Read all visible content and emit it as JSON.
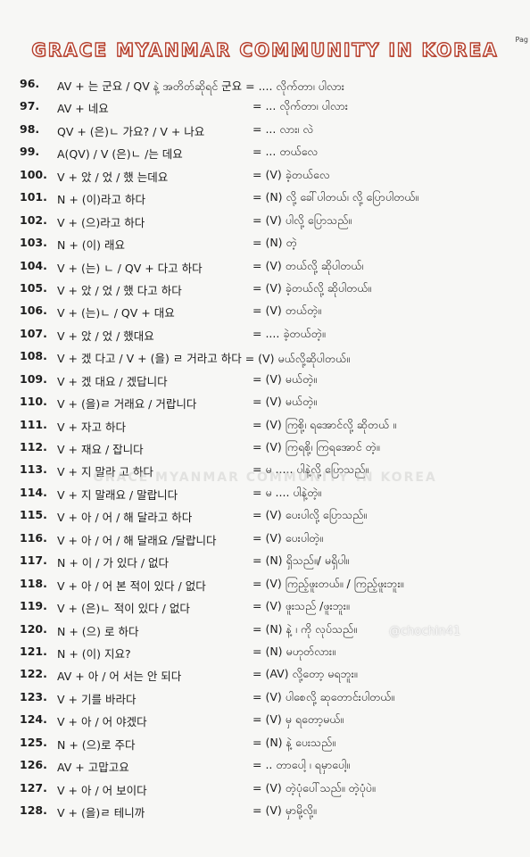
{
  "header": {
    "title": "GRACE MYANMAR COMMUNITY IN KOREA",
    "page_label": "Pag"
  },
  "watermark": "GRACE MYANMAR COMMUNITY IN KOREA",
  "credit": "@chochin41",
  "rows": [
    {
      "num": "96.",
      "form": "AV + 는 군요 / QV နဲ့ အတိတ်ဆိုရင် 군요 = .... လိုက်တာ၊ ပါလား",
      "meaning": ""
    },
    {
      "num": "97.",
      "form": "AV + 네요",
      "meaning": "= ... လိုက်တာ၊ ပါလား"
    },
    {
      "num": "98.",
      "form": "QV + (은)ㄴ 가요? / V + 나요",
      "meaning": "= ... လား၊ လဲ"
    },
    {
      "num": "99.",
      "form": "A(QV) / V (은)ㄴ /는 데요",
      "meaning": "= ... တယ်လေ"
    },
    {
      "num": "100.",
      "form": "V + 았 / 었 / 했 는데요",
      "meaning": "= (V) ခဲ့တယ်လေ"
    },
    {
      "num": "101.",
      "form": "N + (이)라고 하다",
      "meaning": "= (N) လို့ ခေါ်ပါတယ်၊ လို့ ပြောပါတယ်။"
    },
    {
      "num": "102.",
      "form": "V + (으)라고 하다",
      "meaning": "= (V) ပါလို့ ပြောသည်။"
    },
    {
      "num": "103.",
      "form": "N + (이) 래요",
      "meaning": "= (N) တဲ့"
    },
    {
      "num": "104.",
      "form": "V + (는) ㄴ / QV + 다고 하다",
      "meaning": "= (V) တယ်လို့ ဆိုပါတယ်၊"
    },
    {
      "num": "105.",
      "form": "V + 았 / 었 / 했 다고 하다",
      "meaning": "= (V) ခဲ့တယ်လို့ ဆိုပါတယ်။"
    },
    {
      "num": "106.",
      "form": "V + (는)ㄴ / QV + 대요",
      "meaning": "= (V) တယ်တဲ့။"
    },
    {
      "num": "107.",
      "form": "V + 았 / 었 / 했대요",
      "meaning": "= .... ခဲ့တယ်တဲ့။"
    },
    {
      "num": "108.",
      "form": "V + 겠 다고 / V + (을) ㄹ 거라고 하다 = (V) မယ်လို့ဆိုပါတယ်။",
      "meaning": ""
    },
    {
      "num": "109.",
      "form": "V + 겠 대요 / 겠답니다",
      "meaning": "= (V) မယ်တဲ့။"
    },
    {
      "num": "110.",
      "form": "V + (을)ㄹ 거래요 / 거랍니다",
      "meaning": "= (V) မယ်တဲ့။"
    },
    {
      "num": "111.",
      "form": "V + 자고 하다",
      "meaning": "= (V) ကြစို့၊ ရအောင်လို့ ဆိုတယ် ။"
    },
    {
      "num": "112.",
      "form": "V + 재요 / 잡니다",
      "meaning": "= (V) ကြရစို့၊ ကြရအောင် တဲ့။"
    },
    {
      "num": "113.",
      "form": "V + 지 말라 고 하다",
      "meaning": "= မ ..... ပါနဲ့လို့ ပြောသည်။"
    },
    {
      "num": "114.",
      "form": "V + 지 말래요 / 말랍니다",
      "meaning": "= မ .... ပါနဲ့တဲ့။"
    },
    {
      "num": "115.",
      "form": "V + 아 / 어 / 해 달라고 하다",
      "meaning": "= (V) ပေးပါလို့ ပြောသည်။"
    },
    {
      "num": "116.",
      "form": "V + 아 / 어 / 해 달래요 /달랍니다",
      "meaning": "= (V) ပေးပါတဲ့။"
    },
    {
      "num": "117.",
      "form": "N + 이 / 가 있다 / 없다",
      "meaning": "= (N) ရှိသည်။/ မရှိပါ။"
    },
    {
      "num": "118.",
      "form": "V + 아 / 어 본 적이 있다 / 없다",
      "meaning": "= (V) ကြည့်ဖူးတယ်။ / ကြည့်ဖူးဘူး။"
    },
    {
      "num": "119.",
      "form": "V + (은)ㄴ 적이 있다 / 없다",
      "meaning": "= (V) ဖူးသည် /ဖူးဘူး။"
    },
    {
      "num": "120.",
      "form": "N + (으) 로 하다",
      "meaning": "= (N) နဲ့ ၊ ကို လုပ်သည်။"
    },
    {
      "num": "121.",
      "form": "N + (이) 지요?",
      "meaning": "= (N) မဟုတ်လား။"
    },
    {
      "num": "122.",
      "form": "AV + 아 / 어 서는 안 되다",
      "meaning": "= (AV) လို့တော့ မရဘူး။"
    },
    {
      "num": "123.",
      "form": "V + 기를 바라다",
      "meaning": "= (V) ပါစေလို့ ဆုတောင်းပါတယ်။"
    },
    {
      "num": "124.",
      "form": "V + 아 / 어 야겠다",
      "meaning": "= (V) မှ ရတော့မယ်။"
    },
    {
      "num": "125.",
      "form": "N + (으)로 주다",
      "meaning": "= (N) နဲ့ ပေးသည်။"
    },
    {
      "num": "126.",
      "form": "AV + 고맙고요",
      "meaning": "= .. တာပေါ့ ၊ ရမှာပေါ့။"
    },
    {
      "num": "127.",
      "form": "V + 아 / 어 보이다",
      "meaning": "= (V) တဲ့ပုံပေါ်သည်။ တဲ့ပုံပဲ။"
    },
    {
      "num": "128.",
      "form": "V + (을)ㄹ 테니까",
      "meaning": "= (V) မှာမို့လို့။"
    }
  ]
}
